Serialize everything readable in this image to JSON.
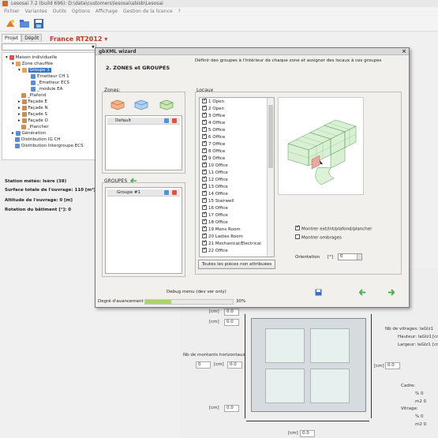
{
  "main": {
    "title": "Lesosai 7.2 (build 696): D:\\data\\customers\\lesosai\\abisb\\Lesosai",
    "menu": [
      "Fichier",
      "Variantes",
      "Outils",
      "Options",
      "Affichage",
      "Gestion de la licence",
      "?"
    ],
    "climate_selector": "France RT2012 ▾",
    "tabs": [
      "Projet",
      "Dépôt"
    ],
    "tree": [
      {
        "label": "Maison individuelle",
        "level": 0,
        "icon_color": "#d9534f"
      },
      {
        "label": "Zone chauffée",
        "level": 1,
        "icon_color": "#e6a057"
      },
      {
        "label": "Groupe 1",
        "level": 2,
        "icon_color": "#e6a057",
        "selected": true
      },
      {
        "label": "Emetteur CH 1",
        "level": 3,
        "icon_color": "#5b8fd1"
      },
      {
        "label": "_Emetteur ECS",
        "level": 3,
        "icon_color": "#5b8fd1"
      },
      {
        "label": "_module EA",
        "level": 3,
        "icon_color": "#5b8fd1"
      },
      {
        "label": "_Plafond",
        "level": 2,
        "icon_color": "#c98f57"
      },
      {
        "label": "Façade E",
        "level": 2,
        "icon_color": "#c98f57"
      },
      {
        "label": "Façade N",
        "level": 2,
        "icon_color": "#c98f57"
      },
      {
        "label": "Façade S",
        "level": 2,
        "icon_color": "#c98f57"
      },
      {
        "label": "Façade O",
        "level": 2,
        "icon_color": "#c98f57"
      },
      {
        "label": "_Plancher",
        "level": 2,
        "icon_color": "#c98f57"
      },
      {
        "label": "Génération",
        "level": 1,
        "icon_color": "#5b8fd1"
      },
      {
        "label": "Distribution IG CH",
        "level": 1,
        "icon_color": "#5b8fd1"
      },
      {
        "label": "Distribution Intergroupe ECS",
        "level": 1,
        "icon_color": "#5b8fd1"
      }
    ],
    "properties": {
      "station": "Station météo: Isère (38)",
      "surface": "Surface totale de l'ouvrage: 110 [m²]",
      "altitude": "Altitude de l'ouvrage: 0 [m]",
      "rotation": "Rotation du bâtiment [°]: 0"
    }
  },
  "geometry": {
    "cm_unit": "[cm]",
    "input_top": "0.0",
    "input_side": "0.0",
    "nb_horizontal": "Nb de montants horizontaux",
    "nb_horizontal_value": "0",
    "input_bottom": "0.0",
    "input_bottom_width": "0.0",
    "input_right": "0.0",
    "nb_vitrages": "Nb de vitrages: laGlz1",
    "hauteur": "Hauteur: laGlz1",
    "largeur": "Largeur: laGlz1",
    "cadre": "Cadre:",
    "vitrage": "Vitrage:",
    "pct": "% 0",
    "m2": "m2 0"
  },
  "dialog": {
    "title": "gbXML wizard",
    "step_title": "2.  ZONES et GROUPES",
    "description": "Définir des groupes à l'intérieur de chaque zone et assigner des locaux à ces groupes",
    "zones_label": "Zones:",
    "zones": [
      "Default"
    ],
    "groups_label": "GROUPES",
    "groups": [
      "Groupe #1"
    ],
    "locaux_label": "Locaux",
    "locaux": [
      "1 Open",
      "2 Open",
      "3 Office",
      "4 Office",
      "5 Office",
      "6 Office",
      "7 Office",
      "8 Office",
      "9 Office",
      "10 Office",
      "11 Office",
      "12 Office",
      "13 Office",
      "14 Office",
      "15 Stairwell",
      "16 Office",
      "17 Office",
      "18 Office",
      "19 Mens Room",
      "20 Ladies Room",
      "21 Mechanical/Electrical",
      "22 Office"
    ],
    "unassigned_button": "Toutes les pièces non attribuées",
    "show_surfaces": "Montrer ext/int/plafond/plancher",
    "show_shading": "Montrer ombrages",
    "orientation_label": "Orientation",
    "orientation_unit": "[°]",
    "orientation_value": "0",
    "debug": "Debug menu (dev ver only)",
    "progress_label": "Degré d'avancement",
    "progress_value": 0.3,
    "progress_text": "30%"
  }
}
